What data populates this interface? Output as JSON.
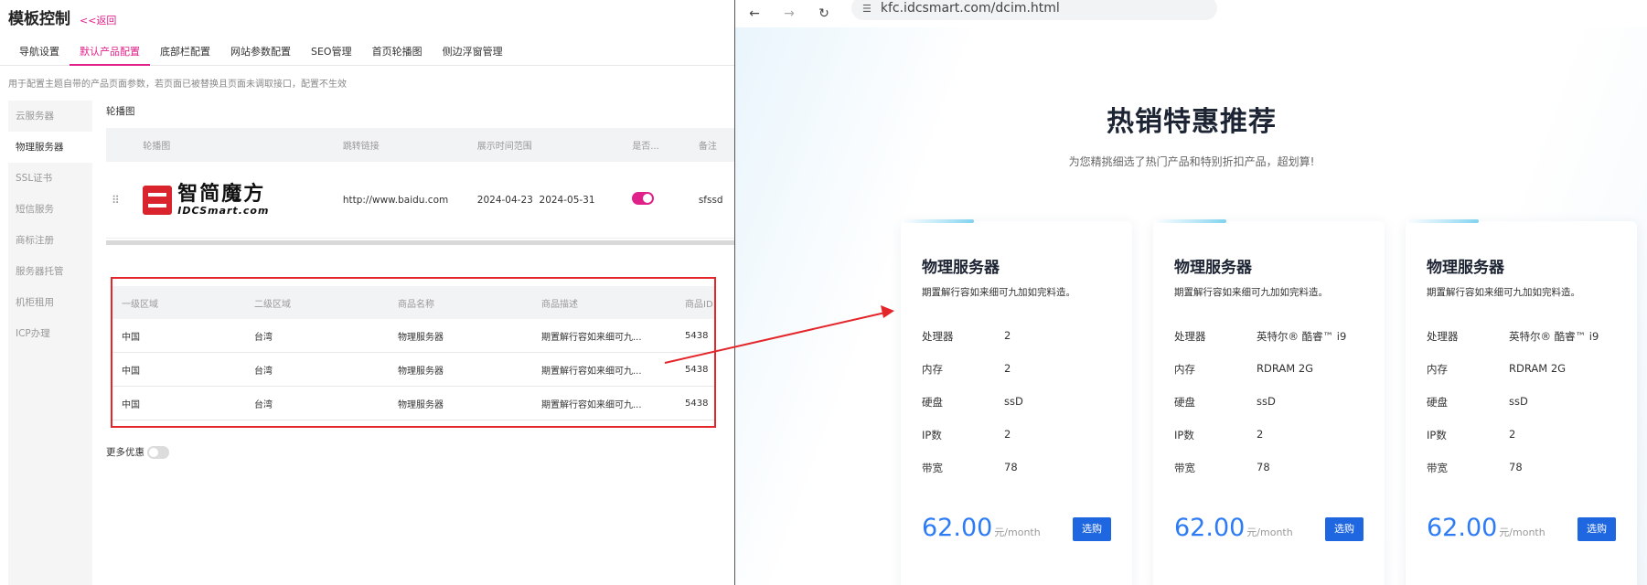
{
  "admin": {
    "title": "模板控制",
    "back_label": "<<返回",
    "tabs": [
      {
        "label": "导航设置",
        "active": false
      },
      {
        "label": "默认产品配置",
        "active": true
      },
      {
        "label": "底部栏配置",
        "active": false
      },
      {
        "label": "网站参数配置",
        "active": false
      },
      {
        "label": "SEO管理",
        "active": false
      },
      {
        "label": "首页轮播图",
        "active": false
      },
      {
        "label": "侧边浮窗管理",
        "active": false
      }
    ],
    "hint": "用于配置主题自带的产品页面参数，若页面已被替换且页面未调取接口，配置不生效",
    "side_menu": [
      {
        "label": "云服务器",
        "active": false
      },
      {
        "label": "物理服务器",
        "active": true
      },
      {
        "label": "SSL证书",
        "active": false
      },
      {
        "label": "短信服务",
        "active": false
      },
      {
        "label": "商标注册",
        "active": false
      },
      {
        "label": "服务器托管",
        "active": false
      },
      {
        "label": "机柜租用",
        "active": false
      },
      {
        "label": "ICP办理",
        "active": false
      }
    ],
    "banner_section": {
      "label": "轮播图",
      "columns": [
        "轮播图",
        "跳转链接",
        "展示时间范围",
        "是否...",
        "备注"
      ],
      "row": {
        "drag_icon": "drag-handle-icon",
        "logo_cn": "智简魔方",
        "logo_en": "IDCSmart.com",
        "link": "http://www.baidu.com",
        "time_start": "2024-04-23",
        "time_end": "2024-05-31",
        "show": true,
        "note": "sfssd"
      }
    },
    "product_table": {
      "columns": [
        "一级区域",
        "二级区域",
        "商品名称",
        "商品描述",
        "商品ID"
      ],
      "rows": [
        [
          "中国",
          "台湾",
          "物理服务器",
          "期置解行容如来细可九...",
          "5438"
        ],
        [
          "中国",
          "台湾",
          "物理服务器",
          "期置解行容如来细可九...",
          "5438"
        ],
        [
          "中国",
          "台湾",
          "物理服务器",
          "期置解行容如来细可九...",
          "5438"
        ]
      ]
    },
    "more_discount": {
      "label": "更多优惠",
      "enabled": false
    },
    "accent_color": "#e0218a",
    "highlight_color": "#e4262b"
  },
  "browser": {
    "url": "kfc.idcsmart.com/dcim.html",
    "back_icon": "arrow-left-icon",
    "forward_icon": "arrow-right-icon",
    "reload_icon": "reload-icon",
    "site_info_icon": "site-info-icon",
    "page": {
      "title": "热销特惠推荐",
      "subtitle": "为您精挑细选了热门产品和特别折扣产品，超划算!",
      "cards": [
        {
          "title": "物理服务器",
          "desc": "期置解行容如来细可九加如完料造。",
          "specs": [
            {
              "k": "处理器",
              "v": "2"
            },
            {
              "k": "内存",
              "v": "2"
            },
            {
              "k": "硬盘",
              "v": "ssD"
            },
            {
              "k": "IP数",
              "v": "2"
            },
            {
              "k": "带宽",
              "v": "78"
            }
          ],
          "price": "62.00",
          "unit": "元/month",
          "button": "选购"
        },
        {
          "title": "物理服务器",
          "desc": "期置解行容如来细可九加如完料造。",
          "specs": [
            {
              "k": "处理器",
              "v": "英特尔® 酷睿™ i9"
            },
            {
              "k": "内存",
              "v": "RDRAM 2G"
            },
            {
              "k": "硬盘",
              "v": "ssD"
            },
            {
              "k": "IP数",
              "v": "2"
            },
            {
              "k": "带宽",
              "v": "78"
            }
          ],
          "price": "62.00",
          "unit": "元/month",
          "button": "选购"
        },
        {
          "title": "物理服务器",
          "desc": "期置解行容如来细可九加如完料造。",
          "specs": [
            {
              "k": "处理器",
              "v": "英特尔® 酷睿™ i9"
            },
            {
              "k": "内存",
              "v": "RDRAM 2G"
            },
            {
              "k": "硬盘",
              "v": "ssD"
            },
            {
              "k": "IP数",
              "v": "2"
            },
            {
              "k": "带宽",
              "v": "78"
            }
          ],
          "price": "62.00",
          "unit": "元/month",
          "button": "选购"
        }
      ],
      "price_color": "#2d7cf6",
      "button_color": "#1f67e0"
    }
  }
}
